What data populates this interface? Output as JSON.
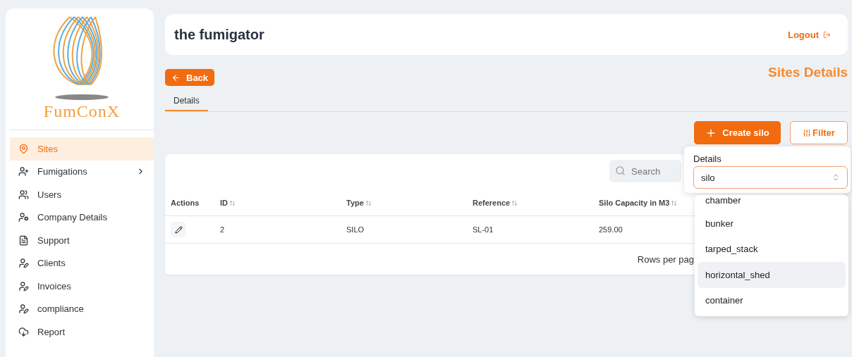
{
  "brand": {
    "name": "FumConX"
  },
  "sidebar": {
    "items": [
      {
        "label": "Sites",
        "selected": true,
        "expandable": false
      },
      {
        "label": "Fumigations",
        "selected": false,
        "expandable": true
      },
      {
        "label": "Users",
        "selected": false,
        "expandable": false
      },
      {
        "label": "Company Details",
        "selected": false,
        "expandable": false
      },
      {
        "label": "Support",
        "selected": false,
        "expandable": false
      },
      {
        "label": "Clients",
        "selected": false,
        "expandable": false
      },
      {
        "label": "Invoices",
        "selected": false,
        "expandable": false
      },
      {
        "label": "compliance",
        "selected": false,
        "expandable": false
      },
      {
        "label": "Report",
        "selected": false,
        "expandable": false
      }
    ]
  },
  "header": {
    "title": "the fumigator",
    "logout": "Logout"
  },
  "back_button": "Back",
  "page_title": "Sites Details",
  "tabs": [
    {
      "label": "Details",
      "selected": true
    }
  ],
  "create_button": "Create silo",
  "filter_button": "Filter",
  "table": {
    "search": {
      "placeholder": "Search"
    },
    "columns": [
      "Actions",
      "ID",
      "Type",
      "Reference",
      "Silo Capacity in M3"
    ],
    "rows": [
      {
        "id": "2",
        "type": "SILO",
        "reference": "SL-01",
        "capacity": "259.00"
      }
    ],
    "footer": "Rows per pag"
  },
  "filter_popover": {
    "label": "Details",
    "value": "silo",
    "options": [
      {
        "label": "chamber",
        "highlighted": false
      },
      {
        "label": "bunker",
        "highlighted": false
      },
      {
        "label": "tarped_stack",
        "highlighted": false
      },
      {
        "label": "horizontal_shed",
        "highlighted": true
      },
      {
        "label": "container",
        "highlighted": false
      }
    ]
  }
}
